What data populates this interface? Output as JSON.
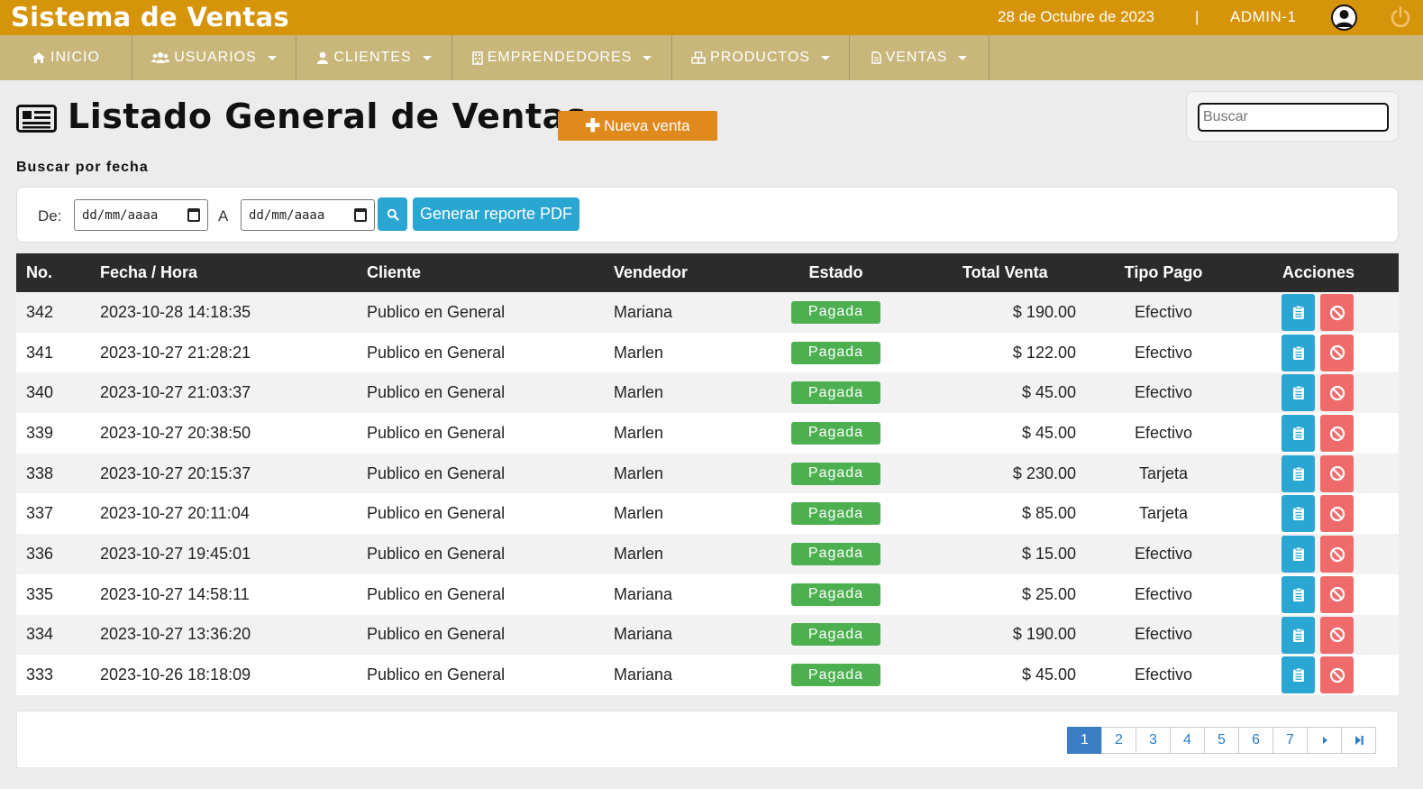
{
  "header": {
    "app_title": "Sistema de Ventas",
    "date": "28 de Octubre de 2023",
    "separator": "|",
    "user": "ADMIN-1"
  },
  "nav": [
    {
      "label": "INICIO",
      "icon": "home-icon",
      "dropdown": false
    },
    {
      "label": "USUARIOS",
      "icon": "users-icon",
      "dropdown": true
    },
    {
      "label": "CLIENTES",
      "icon": "user-icon",
      "dropdown": true
    },
    {
      "label": "EMPRENDEDORES",
      "icon": "building-icon",
      "dropdown": true
    },
    {
      "label": "PRODUCTOS",
      "icon": "cubes-icon",
      "dropdown": true
    },
    {
      "label": "VENTAS",
      "icon": "file-icon",
      "dropdown": true
    }
  ],
  "page": {
    "title": "Listado General de Ventas",
    "new_button": "Nueva venta",
    "search_placeholder": "Buscar"
  },
  "filter": {
    "section_label": "Buscar por fecha",
    "from_label": "De:",
    "to_label": "A",
    "from_value": "dd/mm/aaaa",
    "to_value": "dd/mm/aaaa",
    "pdf_button": "Generar reporte PDF"
  },
  "table": {
    "headers": [
      "No.",
      "Fecha / Hora",
      "Cliente",
      "Vendedor",
      "Estado",
      "Total Venta",
      "Tipo Pago",
      "Acciones"
    ],
    "rows": [
      {
        "no": "342",
        "fecha": "2023-10-28 14:18:35",
        "cliente": "Publico en General",
        "vendedor": "Mariana",
        "estado": "Pagada",
        "total": "$ 190.00",
        "pago": "Efectivo"
      },
      {
        "no": "341",
        "fecha": "2023-10-27 21:28:21",
        "cliente": "Publico en General",
        "vendedor": "Marlen",
        "estado": "Pagada",
        "total": "$ 122.00",
        "pago": "Efectivo"
      },
      {
        "no": "340",
        "fecha": "2023-10-27 21:03:37",
        "cliente": "Publico en General",
        "vendedor": "Marlen",
        "estado": "Pagada",
        "total": "$ 45.00",
        "pago": "Efectivo"
      },
      {
        "no": "339",
        "fecha": "2023-10-27 20:38:50",
        "cliente": "Publico en General",
        "vendedor": "Marlen",
        "estado": "Pagada",
        "total": "$ 45.00",
        "pago": "Efectivo"
      },
      {
        "no": "338",
        "fecha": "2023-10-27 20:15:37",
        "cliente": "Publico en General",
        "vendedor": "Marlen",
        "estado": "Pagada",
        "total": "$ 230.00",
        "pago": "Tarjeta"
      },
      {
        "no": "337",
        "fecha": "2023-10-27 20:11:04",
        "cliente": "Publico en General",
        "vendedor": "Marlen",
        "estado": "Pagada",
        "total": "$ 85.00",
        "pago": "Tarjeta"
      },
      {
        "no": "336",
        "fecha": "2023-10-27 19:45:01",
        "cliente": "Publico en General",
        "vendedor": "Marlen",
        "estado": "Pagada",
        "total": "$ 15.00",
        "pago": "Efectivo"
      },
      {
        "no": "335",
        "fecha": "2023-10-27 14:58:11",
        "cliente": "Publico en General",
        "vendedor": "Mariana",
        "estado": "Pagada",
        "total": "$ 25.00",
        "pago": "Efectivo"
      },
      {
        "no": "334",
        "fecha": "2023-10-27 13:36:20",
        "cliente": "Publico en General",
        "vendedor": "Mariana",
        "estado": "Pagada",
        "total": "$ 190.00",
        "pago": "Efectivo"
      },
      {
        "no": "333",
        "fecha": "2023-10-26 18:18:09",
        "cliente": "Publico en General",
        "vendedor": "Mariana",
        "estado": "Pagada",
        "total": "$ 45.00",
        "pago": "Efectivo"
      }
    ]
  },
  "pagination": {
    "pages": [
      "1",
      "2",
      "3",
      "4",
      "5",
      "6",
      "7"
    ],
    "current": "1"
  },
  "colors": {
    "topbar": "#d6940a",
    "navbar": "#c9b67b",
    "new_button": "#e08a1e",
    "info": "#2aa6d2",
    "danger": "#ef6b6b",
    "success": "#4caf50",
    "table_header": "#2b2b2b"
  }
}
